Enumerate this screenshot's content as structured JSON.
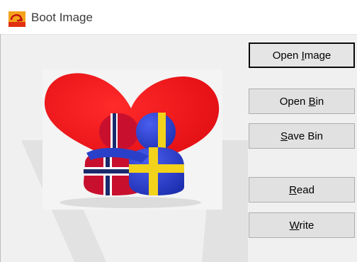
{
  "window": {
    "title": "Boot Image",
    "icon": "app-logo-icon"
  },
  "buttons": [
    {
      "id": "open-image",
      "pre": "Open ",
      "mnemonic": "I",
      "post": "mage"
    },
    {
      "id": "open-bin",
      "pre": "Open ",
      "mnemonic": "B",
      "post": "in"
    },
    {
      "id": "save-bin",
      "pre": "",
      "mnemonic": "S",
      "post": "ave Bin"
    },
    {
      "id": "read",
      "pre": "",
      "mnemonic": "R",
      "post": "ead"
    },
    {
      "id": "write",
      "pre": "",
      "mnemonic": "W",
      "post": "rite"
    }
  ],
  "image": {
    "description_icon": "heart-flags-picture"
  },
  "colors": {
    "heart": "#e8161c",
    "norway_red": "#c8102e",
    "norway_blue": "#1a2a6c",
    "sweden_blue": "#2a40c8",
    "sweden_yellow": "#f2d21a"
  }
}
